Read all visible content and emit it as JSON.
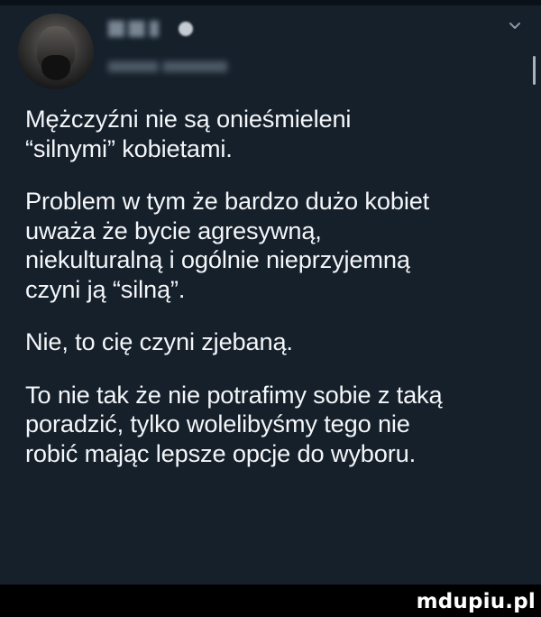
{
  "post": {
    "paragraphs": [
      "Mężczyźni nie są onieśmieleni\n“silnymi” kobietami.",
      "Problem w tym że bardzo dużo kobiet\nuważa że bycie agresywną,\nniekulturalną i ogólnie nieprzyjemną\nczyni ją “silną”.",
      "Nie, to cię czyni zjebaną.",
      "To nie tak że nie potrafimy sobie z taką\nporadzić, tylko wolelibyśmy tego nie\nrobić mając lepsze opcje do wyboru."
    ]
  },
  "icons": {
    "more": "chevron-down-icon"
  },
  "watermark": "mdupiu.pl",
  "colors": {
    "background": "#15202b",
    "text": "#f4f6f8",
    "muted": "#8b98a5",
    "border": "#000000"
  }
}
